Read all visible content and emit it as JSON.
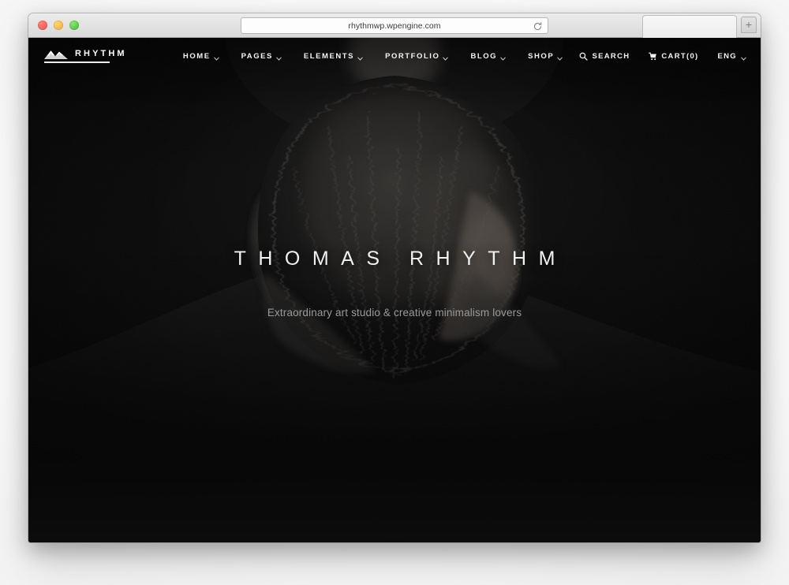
{
  "browser": {
    "url": "rhythmwp.wpengine.com",
    "reload_icon": "reload-icon",
    "new_tab_label": "+",
    "traffic_lights": [
      "close",
      "minimize",
      "zoom"
    ]
  },
  "site": {
    "brand": {
      "name": "RHYTHM",
      "icon": "mountain-icon"
    },
    "nav": [
      {
        "label": "HOME",
        "has_dropdown": true
      },
      {
        "label": "PAGES",
        "has_dropdown": true
      },
      {
        "label": "ELEMENTS",
        "has_dropdown": true
      },
      {
        "label": "PORTFOLIO",
        "has_dropdown": true
      },
      {
        "label": "BLOG",
        "has_dropdown": true
      },
      {
        "label": "SHOP",
        "has_dropdown": true
      }
    ],
    "utility_nav": [
      {
        "label": "SEARCH",
        "icon": "search-icon"
      },
      {
        "label": "CART(0)",
        "icon": "cart-icon"
      },
      {
        "label": "ENG",
        "icon": "chevron-down-icon",
        "has_dropdown": true
      }
    ],
    "hero": {
      "title": "THOMAS RHYTHM",
      "subtitle": "Extraordinary art studio & creative minimalism lovers",
      "scroll_indicator_icon": "chevron-down-icon"
    },
    "colors": {
      "page_background": "#0d0d0e",
      "text_primary": "#f0f0f0",
      "text_muted": "#9a9a9a",
      "accent": "#ffffff"
    }
  }
}
